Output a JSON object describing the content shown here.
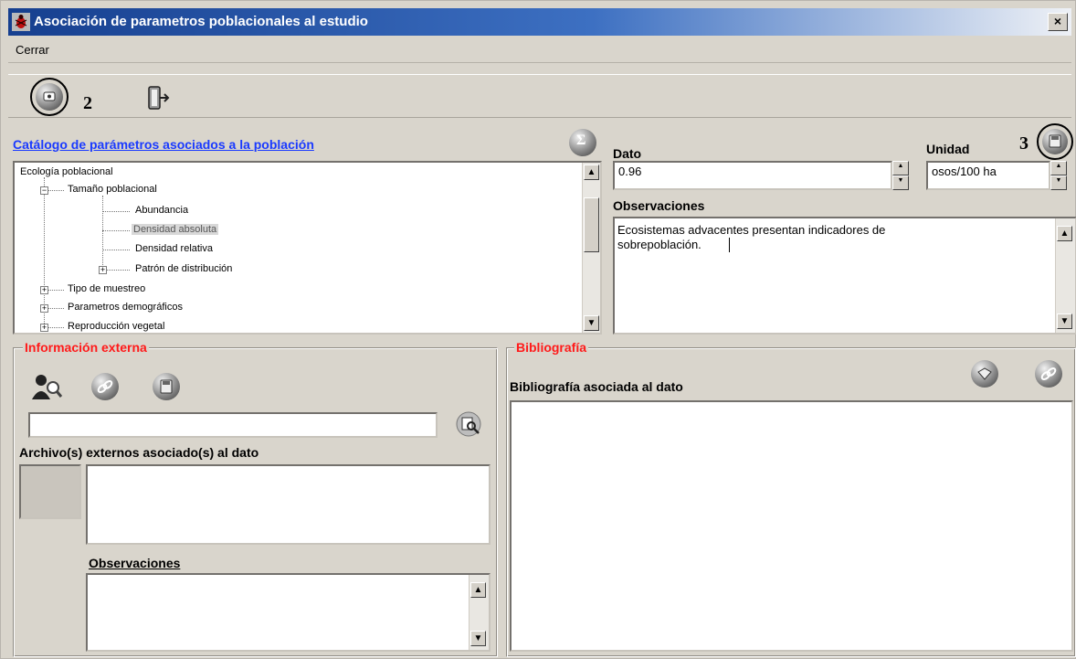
{
  "window": {
    "title": "Asociación de parametros poblacionales al estudio",
    "close_glyph": "×",
    "icon": "app-bug-icon"
  },
  "menu": {
    "items": [
      "Cerrar"
    ]
  },
  "toolbar": {
    "annotation_2": "2",
    "buttons": [
      "db-connect-icon",
      "exit-door-icon"
    ]
  },
  "catalog": {
    "title": "Catálogo de parámetros asociados a la población",
    "icon": "stats-sigma-icon",
    "tree": [
      {
        "label": "Ecología poblacional",
        "level": 0,
        "selected": false
      },
      {
        "label": "Tamaño poblacional",
        "level": 1,
        "selected": false
      },
      {
        "label": "Abundancia",
        "level": 2,
        "selected": false
      },
      {
        "label": "Densidad absoluta",
        "level": 2,
        "selected": true
      },
      {
        "label": "Densidad relativa",
        "level": 2,
        "selected": false
      },
      {
        "label": "Patrón de distribución",
        "level": 2,
        "selected": false
      },
      {
        "label": "Tipo de muestreo",
        "level": 1,
        "selected": false
      },
      {
        "label": "Parametros demográficos",
        "level": 1,
        "selected": false
      },
      {
        "label": "Reproducción vegetal",
        "level": 1,
        "selected": false
      }
    ]
  },
  "dato": {
    "label": "Dato",
    "value": "0.96"
  },
  "unidad": {
    "label": "Unidad",
    "value": "osos/100 ha",
    "annotation_3": "3"
  },
  "observaciones": {
    "label": "Observaciones",
    "line1": "Ecosistemas advacentes presentan indicadores de",
    "line2": "sobrepoblación."
  },
  "info_externa": {
    "title": "Información externa",
    "path_value": "",
    "files_label": "Archivo(s) externos asociado(s) al dato",
    "obs_label": "Observaciones"
  },
  "bibliografia": {
    "title": "Bibliografía",
    "subtitle": "Bibliografía asociada al dato"
  },
  "colors": {
    "titlebar_start": "#163f8f",
    "link": "#1a3aff",
    "group_title": "#ff1a1a",
    "window_bg": "#d9d5cc"
  }
}
